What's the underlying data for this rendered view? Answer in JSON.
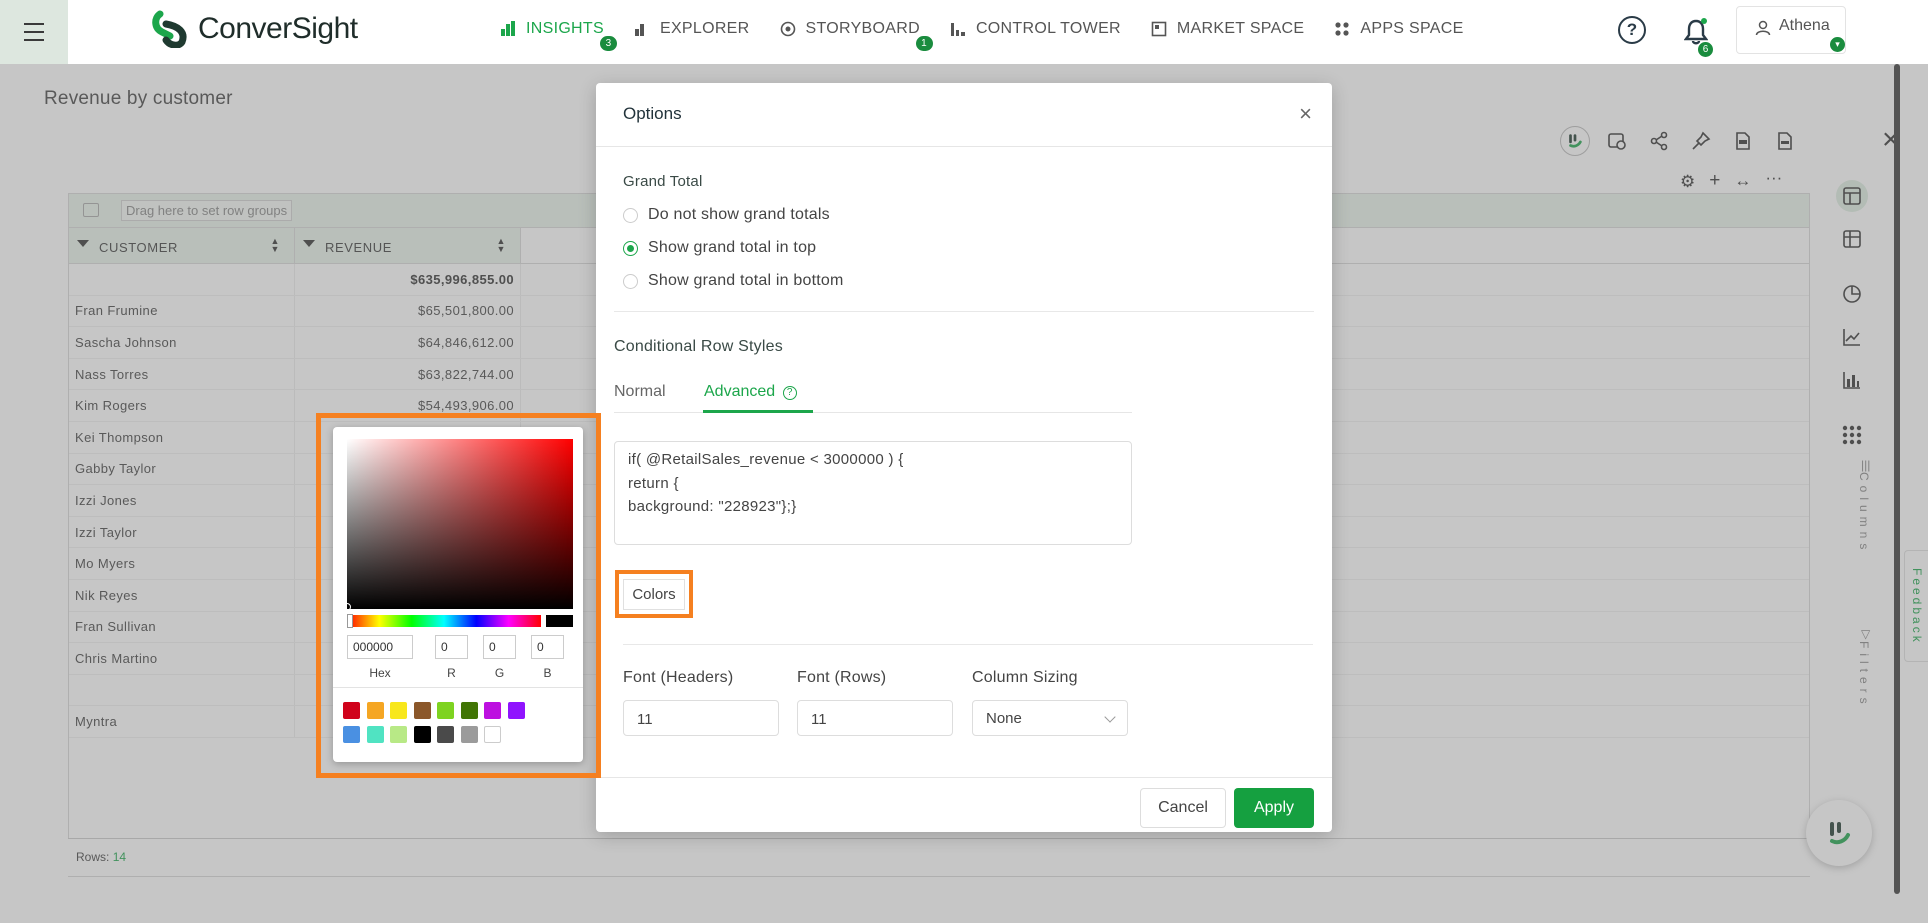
{
  "app": {
    "brand": "ConverSight",
    "nav": [
      {
        "label": "INSIGHTS",
        "badge": "3"
      },
      {
        "label": "EXPLORER",
        "badge": ""
      },
      {
        "label": "STORYBOARD",
        "badge": "1"
      },
      {
        "label": "CONTROL TOWER",
        "badge": ""
      },
      {
        "label": "MARKET SPACE",
        "badge": ""
      },
      {
        "label": "APPS SPACE",
        "badge": ""
      }
    ],
    "notifications": "6",
    "user": "Athena",
    "accent": "#1ca64b"
  },
  "page": {
    "title": "Revenue by customer",
    "group_placeholder": "Drag here to set row groups",
    "columns": [
      "CUSTOMER",
      "REVENUE"
    ],
    "total": "$635,996,855.00",
    "rows": [
      {
        "customer": "Fran Frumine",
        "revenue": "$65,501,800.00"
      },
      {
        "customer": "Sascha Johnson",
        "revenue": "$64,846,612.00"
      },
      {
        "customer": "Nass Torres",
        "revenue": "$63,822,744.00"
      },
      {
        "customer": "Kim Rogers",
        "revenue": "$54,493,906.00"
      },
      {
        "customer": "Kei Thompson",
        "revenue": ""
      },
      {
        "customer": "Gabby Taylor",
        "revenue": ""
      },
      {
        "customer": "Izzi Jones",
        "revenue": ""
      },
      {
        "customer": "Izzi Taylor",
        "revenue": ""
      },
      {
        "customer": "Mo Myers",
        "revenue": ""
      },
      {
        "customer": "Nik Reyes",
        "revenue": ""
      },
      {
        "customer": "Fran Sullivan",
        "revenue": ""
      },
      {
        "customer": "Chris Martino",
        "revenue": ""
      },
      {
        "customer": "",
        "revenue": ""
      },
      {
        "customer": "Myntra",
        "revenue": ""
      }
    ],
    "side_tabs": [
      "Columns",
      "Filters"
    ],
    "rows_label": "Rows:",
    "rows_count": "14",
    "feedback": "Feedback"
  },
  "dialog": {
    "title": "Options",
    "grand_total_label": "Grand Total",
    "grand_total_options": [
      {
        "label": "Do not show grand totals",
        "selected": false
      },
      {
        "label": "Show grand total in top",
        "selected": true
      },
      {
        "label": "Show grand total in bottom",
        "selected": false
      }
    ],
    "conditional_label": "Conditional Row Styles",
    "tabs": [
      {
        "label": "Normal",
        "active": false
      },
      {
        "label": "Advanced",
        "active": true
      }
    ],
    "code": "if( @RetailSales_revenue < 3000000 ) {\nreturn {\nbackground: \"228923\"};}",
    "colors_button": "Colors",
    "font_headers_label": "Font (Headers)",
    "font_headers_value": "11",
    "font_rows_label": "Font (Rows)",
    "font_rows_value": "11",
    "column_sizing_label": "Column Sizing",
    "column_sizing_value": "None",
    "cancel": "Cancel",
    "apply": "Apply"
  },
  "color_picker": {
    "hex": "000000",
    "r": "0",
    "g": "0",
    "b": "0",
    "labels": {
      "hex": "Hex",
      "r": "R",
      "g": "G",
      "b": "B"
    },
    "swatches": [
      "#d0021b",
      "#f5a623",
      "#f8e71c",
      "#8b572a",
      "#7ed321",
      "#417505",
      "#bd10e0",
      "#9013fe",
      "#4a90e2",
      "#50e3c2",
      "#b8e986",
      "#000000",
      "#4a4a4a",
      "#9b9b9b",
      "#ffffff"
    ],
    "highlight": "#f58020"
  }
}
